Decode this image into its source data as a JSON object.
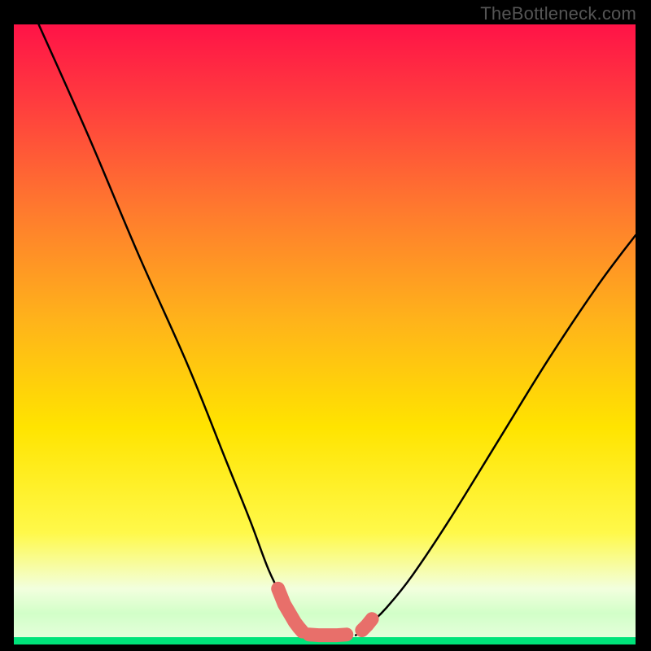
{
  "watermark": "TheBottleneck.com",
  "chart_data": {
    "type": "line",
    "title": "",
    "xlabel": "",
    "ylabel": "",
    "xlim": [
      0,
      100
    ],
    "ylim": [
      0,
      100
    ],
    "grid": false,
    "background_gradient": {
      "top_color": "#ff1347",
      "mid_color": "#ffe400",
      "bottom_band_color": "#00e37a",
      "bottom_band_start": 95
    },
    "series": [
      {
        "name": "left-curve",
        "x": [
          4,
          12,
          20,
          28,
          34,
          38,
          41,
          43.5,
          45,
          46,
          47,
          48
        ],
        "y": [
          100,
          82,
          63,
          45,
          30,
          20,
          12,
          7,
          4.5,
          3,
          2,
          1.5
        ],
        "color": "#000000"
      },
      {
        "name": "right-curve",
        "x": [
          55,
          56,
          57.5,
          60,
          64,
          70,
          78,
          86,
          94,
          100
        ],
        "y": [
          1.5,
          2.2,
          3.5,
          6,
          11,
          20,
          33,
          46,
          58,
          66
        ],
        "color": "#000000"
      },
      {
        "name": "left-marker-cluster",
        "x": [
          42.5,
          43.5,
          44.5,
          45.2,
          45.8,
          46.4
        ],
        "y": [
          9.0,
          6.5,
          4.8,
          3.6,
          2.8,
          2.1
        ],
        "color": "#e86f6a",
        "style": "markers"
      },
      {
        "name": "trough-marker-cluster",
        "x": [
          47.5,
          49.0,
          50.5,
          52.0,
          53.5
        ],
        "y": [
          1.6,
          1.5,
          1.5,
          1.5,
          1.6
        ],
        "color": "#e86f6a",
        "style": "markers"
      },
      {
        "name": "right-marker-cluster",
        "x": [
          56.0,
          56.8,
          57.6
        ],
        "y": [
          2.3,
          3.1,
          4.1
        ],
        "color": "#e86f6a",
        "style": "markers"
      }
    ]
  }
}
